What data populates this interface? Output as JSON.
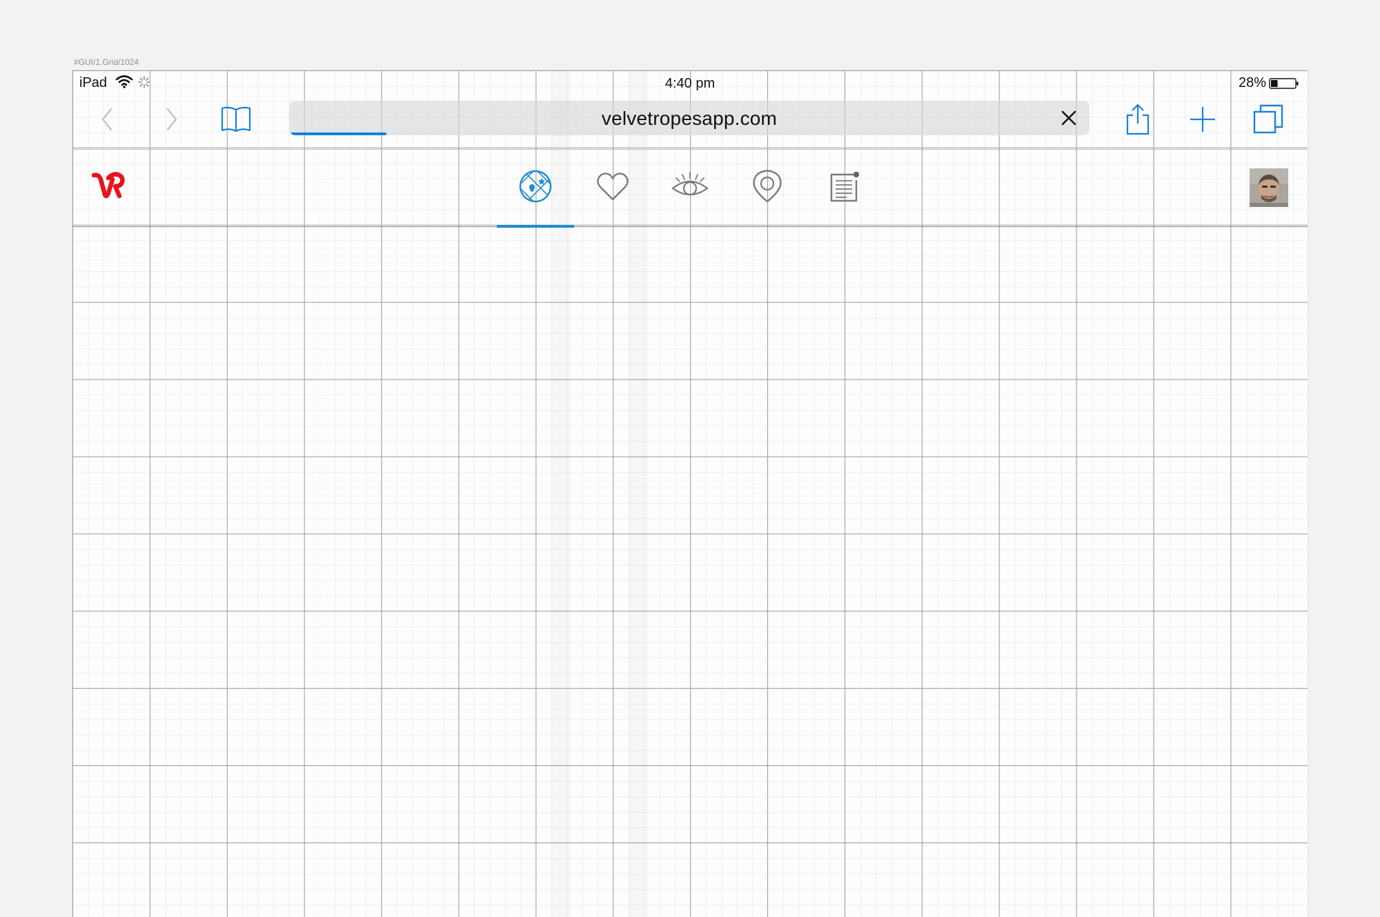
{
  "frame_label": "#GUI/1.Grid/1024",
  "status_bar": {
    "device": "iPad",
    "time": "4:40 pm",
    "battery": "28%",
    "battery_level": 0.28
  },
  "browser": {
    "url": "velvetropesapp.com",
    "load_progress": 0.12,
    "accent_color": "#1a7fdc",
    "icons": [
      "back-icon",
      "forward-icon",
      "bookmarks-icon",
      "clear-icon",
      "share-icon",
      "new-tab-icon",
      "tabs-icon"
    ]
  },
  "app": {
    "logo_text": "VR",
    "logo_color": "#e8141c",
    "active_tab": "explore",
    "active_color": "#1e8bd0",
    "tabs": [
      {
        "id": "explore",
        "icon": "explore-map-icon"
      },
      {
        "id": "favorites",
        "icon": "heart-icon"
      },
      {
        "id": "watching",
        "icon": "eye-icon"
      },
      {
        "id": "locations",
        "icon": "location-pin-icon"
      },
      {
        "id": "notes",
        "icon": "notes-icon"
      }
    ]
  }
}
